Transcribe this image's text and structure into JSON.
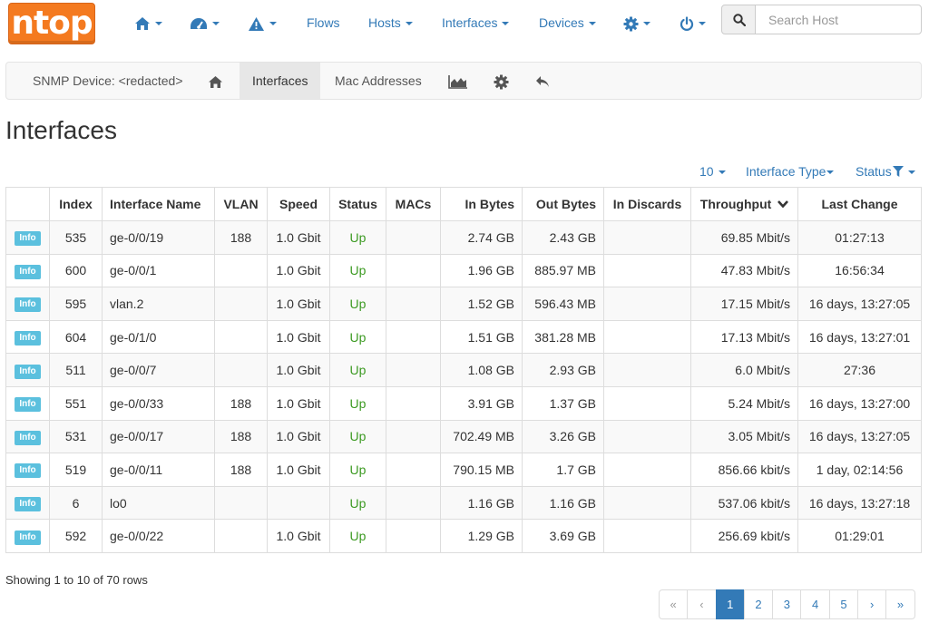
{
  "brand": {
    "logo_text": "ntop",
    "accent": "#f47a20",
    "link_color": "#337ab7"
  },
  "nav": {
    "home_icon": "home-icon",
    "dashboard_icon": "dashboard-icon",
    "alerts_icon": "warning-icon",
    "flows": "Flows",
    "hosts": "Hosts",
    "interfaces": "Interfaces",
    "devices": "Devices",
    "settings_icon": "gear-icon",
    "power_icon": "power-icon",
    "search_placeholder": "Search Host"
  },
  "subbar": {
    "device": "SNMP Device: <redacted>",
    "interfaces": "Interfaces",
    "mac_addresses": "Mac Addresses",
    "chart_icon": "area-chart-icon",
    "config_icon": "gear-icon",
    "back_icon": "reply-icon"
  },
  "page_title": "Interfaces",
  "toolbar": {
    "per_page": "10",
    "interface_type": "Interface Type",
    "status": "Status"
  },
  "table": {
    "columns": [
      "",
      "Index",
      "Interface Name",
      "VLAN",
      "Speed",
      "Status",
      "MACs",
      "In Bytes",
      "Out Bytes",
      "In Discards",
      "Throughput",
      "Last Change"
    ],
    "info_label": "Info",
    "rows": [
      {
        "index": "535",
        "name": "ge-0/0/19",
        "vlan": "188",
        "speed": "1.0 Gbit",
        "status": "Up",
        "macs": "",
        "in_bytes": "2.74 GB",
        "out_bytes": "2.43 GB",
        "in_discards": "",
        "throughput": "69.85 Mbit/s",
        "last_change": "01:27:13"
      },
      {
        "index": "600",
        "name": "ge-0/0/1",
        "vlan": "",
        "speed": "1.0 Gbit",
        "status": "Up",
        "macs": "",
        "in_bytes": "1.96 GB",
        "out_bytes": "885.97 MB",
        "in_discards": "",
        "throughput": "47.83 Mbit/s",
        "last_change": "16:56:34"
      },
      {
        "index": "595",
        "name": "vlan.2",
        "vlan": "",
        "speed": "1.0 Gbit",
        "status": "Up",
        "macs": "",
        "in_bytes": "1.52 GB",
        "out_bytes": "596.43 MB",
        "in_discards": "",
        "throughput": "17.15 Mbit/s",
        "last_change": "16 days, 13:27:05"
      },
      {
        "index": "604",
        "name": "ge-0/1/0",
        "vlan": "",
        "speed": "1.0 Gbit",
        "status": "Up",
        "macs": "",
        "in_bytes": "1.51 GB",
        "out_bytes": "381.28 MB",
        "in_discards": "",
        "throughput": "17.13 Mbit/s",
        "last_change": "16 days, 13:27:01"
      },
      {
        "index": "511",
        "name": "ge-0/0/7",
        "vlan": "",
        "speed": "1.0 Gbit",
        "status": "Up",
        "macs": "",
        "in_bytes": "1.08 GB",
        "out_bytes": "2.93 GB",
        "in_discards": "",
        "throughput": "6.0 Mbit/s",
        "last_change": "27:36"
      },
      {
        "index": "551",
        "name": "ge-0/0/33",
        "vlan": "188",
        "speed": "1.0 Gbit",
        "status": "Up",
        "macs": "",
        "in_bytes": "3.91 GB",
        "out_bytes": "1.37 GB",
        "in_discards": "",
        "throughput": "5.24 Mbit/s",
        "last_change": "16 days, 13:27:00"
      },
      {
        "index": "531",
        "name": "ge-0/0/17",
        "vlan": "188",
        "speed": "1.0 Gbit",
        "status": "Up",
        "macs": "",
        "in_bytes": "702.49 MB",
        "out_bytes": "3.26 GB",
        "in_discards": "",
        "throughput": "3.05 Mbit/s",
        "last_change": "16 days, 13:27:05"
      },
      {
        "index": "519",
        "name": "ge-0/0/11",
        "vlan": "188",
        "speed": "1.0 Gbit",
        "status": "Up",
        "macs": "",
        "in_bytes": "790.15 MB",
        "out_bytes": "1.7 GB",
        "in_discards": "",
        "throughput": "856.66 kbit/s",
        "last_change": "1 day, 02:14:56"
      },
      {
        "index": "6",
        "name": "lo0",
        "vlan": "",
        "speed": "",
        "status": "Up",
        "macs": "",
        "in_bytes": "1.16 GB",
        "out_bytes": "1.16 GB",
        "in_discards": "",
        "throughput": "537.06 kbit/s",
        "last_change": "16 days, 13:27:18"
      },
      {
        "index": "592",
        "name": "ge-0/0/22",
        "vlan": "",
        "speed": "1.0 Gbit",
        "status": "Up",
        "macs": "",
        "in_bytes": "1.29 GB",
        "out_bytes": "3.69 GB",
        "in_discards": "",
        "throughput": "256.69 kbit/s",
        "last_change": "01:29:01"
      }
    ]
  },
  "showing": "Showing 1 to 10 of 70 rows",
  "pagination": [
    "«",
    "‹",
    "1",
    "2",
    "3",
    "4",
    "5",
    "›",
    "»"
  ],
  "current_page": "1"
}
